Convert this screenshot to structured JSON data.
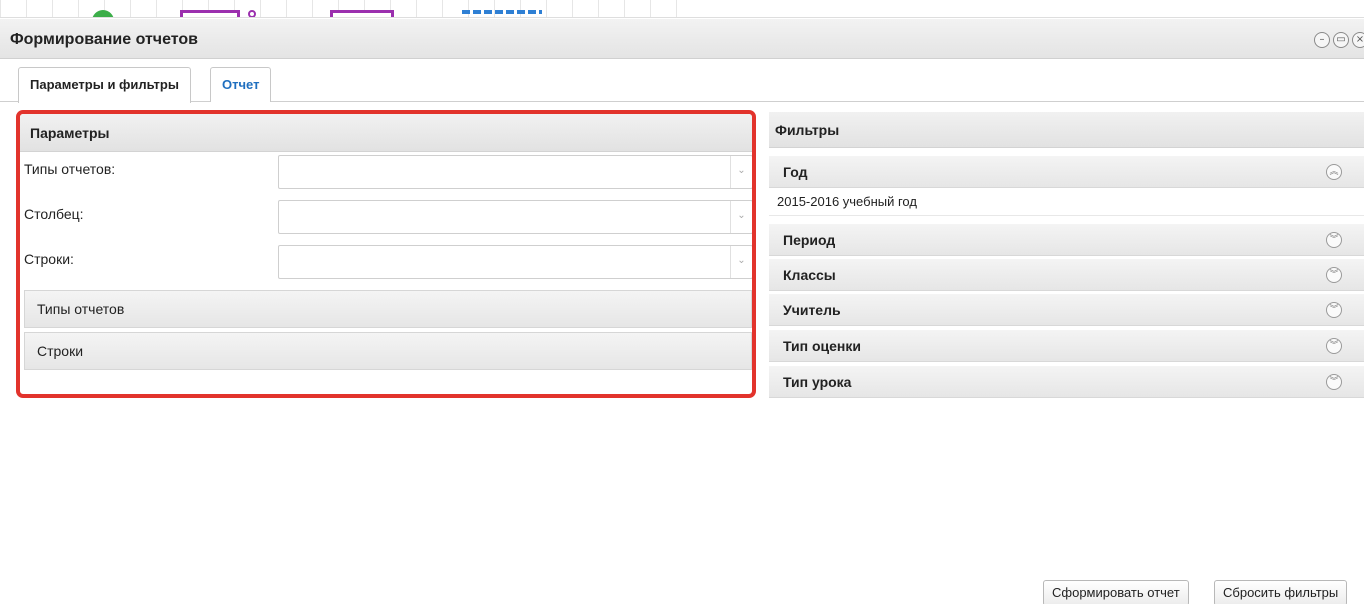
{
  "window": {
    "title": "Формирование отчетов"
  },
  "tabs": [
    {
      "label": "Параметры и фильтры"
    },
    {
      "label": "Отчет"
    }
  ],
  "params": {
    "title": "Параметры",
    "fields": [
      {
        "label": "Типы отчетов:",
        "value": ""
      },
      {
        "label": "Столбец:",
        "value": ""
      },
      {
        "label": "Строки:",
        "value": ""
      }
    ],
    "sections": [
      {
        "label": "Типы отчетов"
      },
      {
        "label": "Строки"
      }
    ]
  },
  "filters": {
    "title": "Фильтры",
    "items": [
      {
        "label": "Год",
        "expanded": true,
        "value": "2015-2016 учебный год"
      },
      {
        "label": "Период",
        "expanded": false
      },
      {
        "label": "Классы",
        "expanded": false
      },
      {
        "label": "Учитель",
        "expanded": false
      },
      {
        "label": "Тип оценки",
        "expanded": false
      },
      {
        "label": "Тип урока",
        "expanded": false
      }
    ]
  },
  "buttons": {
    "generate": "Сформировать отчет",
    "reset": "Сбросить фильтры"
  },
  "icons": {
    "chevron_collapse": "double-chevron-up-icon",
    "chevron_expand": "double-chevron-down-icon",
    "minimize": "minimize-icon",
    "restore": "restore-icon",
    "close": "close-icon"
  },
  "colors": {
    "highlight": "#e2332c",
    "link": "#1f6fbf"
  }
}
